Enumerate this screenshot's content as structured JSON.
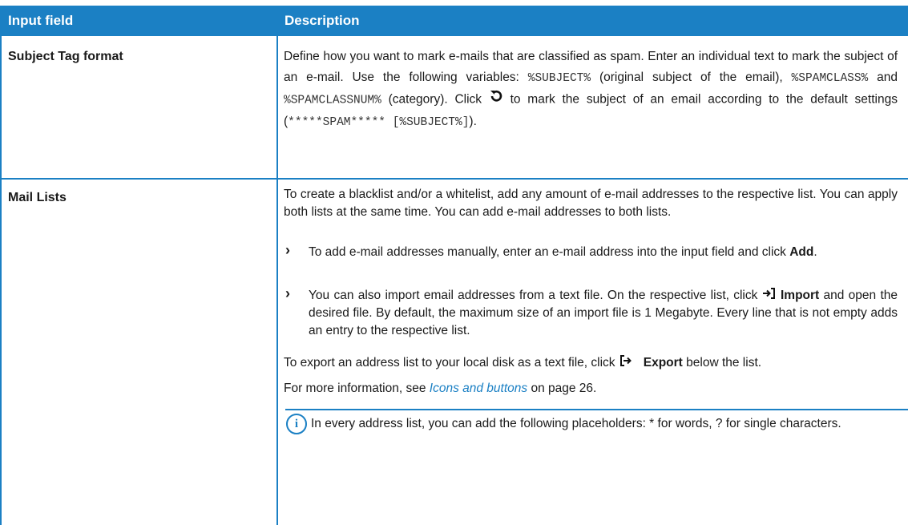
{
  "table": {
    "headers": [
      "Input field",
      "Description"
    ],
    "rows": [
      {
        "field": "Subject Tag format",
        "desc": {
          "line1": "Define how you want to mark e-mails that are classified as spam. Enter an individual text to mark the subject of an e-mail. Use the following variables: ",
          "var_subject": "%SUBJECT%",
          "mid1": " (original subject of the email), ",
          "var_spamclass": "%SPAMCLASS%",
          "and": " and ",
          "var_spamclassnum": "%SPAMCLASSNUM%",
          "mid2": " (category). Click ",
          "mid3": " to mark the subject of an email according to the default settings (",
          "default_value": "*****SPAM***** [%SUBJECT%]",
          "end": ")."
        }
      },
      {
        "field": "Mail Lists",
        "intro": "To create a blacklist and/or a whitelist, add any amount of e-mail addresses to the respective list. You can apply both lists at the same time. You can add e-mail addresses to both lists.",
        "bullet1_text": "To add e-mail addresses manually, enter an e-mail address into the input field and click ",
        "bullet1_bold": "Add",
        "bullet1_end": ".",
        "bullet2_text": "You can also import email addresses from a text file. On the respective list, click ",
        "bullet2_bold": "Import",
        "bullet2_end": " and open the desired file. By default, the maximum size of an import file is 1 Megabyte. Every line that is not empty adds an entry to the respective list.",
        "export_text": "To export an address list to your local disk as a text file, click ",
        "export_bold": "Export",
        "export_end": " below the list.",
        "more_text": "For more information, see ",
        "more_link": "Icons and buttons",
        "more_end": " on page 26.",
        "note": "In every address list, you can add the following placeholders: * for words, ? for single characters."
      }
    ]
  },
  "colors": {
    "accent": "#1b80c4",
    "header_text": "#ffffff"
  },
  "icons": [
    "reset-icon",
    "chevron-right-icon",
    "import-icon",
    "export-icon",
    "info-icon"
  ]
}
